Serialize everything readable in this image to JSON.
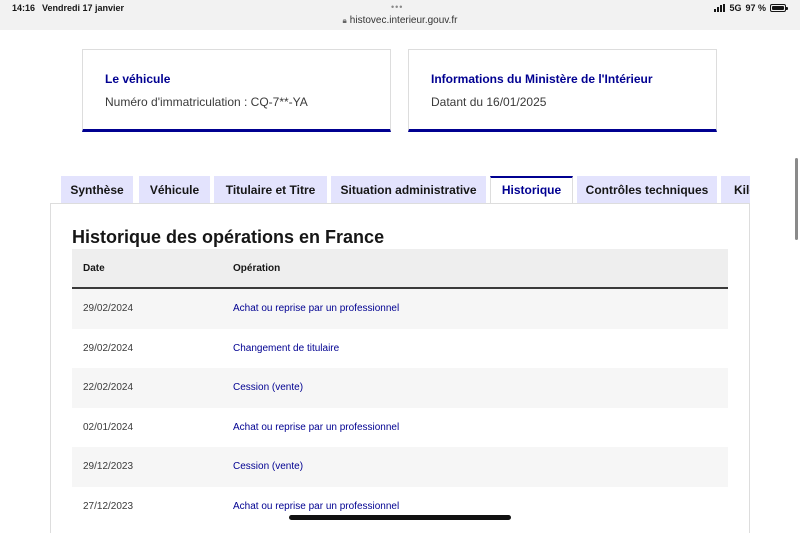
{
  "status_bar": {
    "time": "14:16",
    "date": "Vendredi 17 janvier",
    "url": "histovec.interieur.gouv.fr",
    "network": "5G",
    "battery": "97 %",
    "battery_level": 0.97
  },
  "cards": {
    "vehicle": {
      "title": "Le véhicule",
      "text": "Numéro d'immatriculation : CQ-7**-YA"
    },
    "ministry": {
      "title": "Informations du Ministère de l'Intérieur",
      "text": "Datant du 16/01/2025"
    }
  },
  "tabs": [
    {
      "label": "Synthèse"
    },
    {
      "label": "Véhicule"
    },
    {
      "label": "Titulaire et Titre"
    },
    {
      "label": "Situation administrative"
    },
    {
      "label": "Historique",
      "active": true
    },
    {
      "label": "Contrôles techniques"
    },
    {
      "label": "Kilométrage"
    }
  ],
  "history": {
    "title": "Historique des opérations en France",
    "columns": {
      "date": "Date",
      "operation": "Opération"
    },
    "rows": [
      {
        "date": "29/02/2024",
        "operation": "Achat ou reprise par un professionnel"
      },
      {
        "date": "29/02/2024",
        "operation": "Changement de titulaire"
      },
      {
        "date": "22/02/2024",
        "operation": "Cession (vente)"
      },
      {
        "date": "02/01/2024",
        "operation": "Achat ou reprise par un professionnel"
      },
      {
        "date": "29/12/2023",
        "operation": "Cession (vente)"
      },
      {
        "date": "27/12/2023",
        "operation": "Achat ou reprise par un professionnel"
      }
    ]
  },
  "colors": {
    "accent": "#000091",
    "tab_background": "#e3e3fd"
  }
}
